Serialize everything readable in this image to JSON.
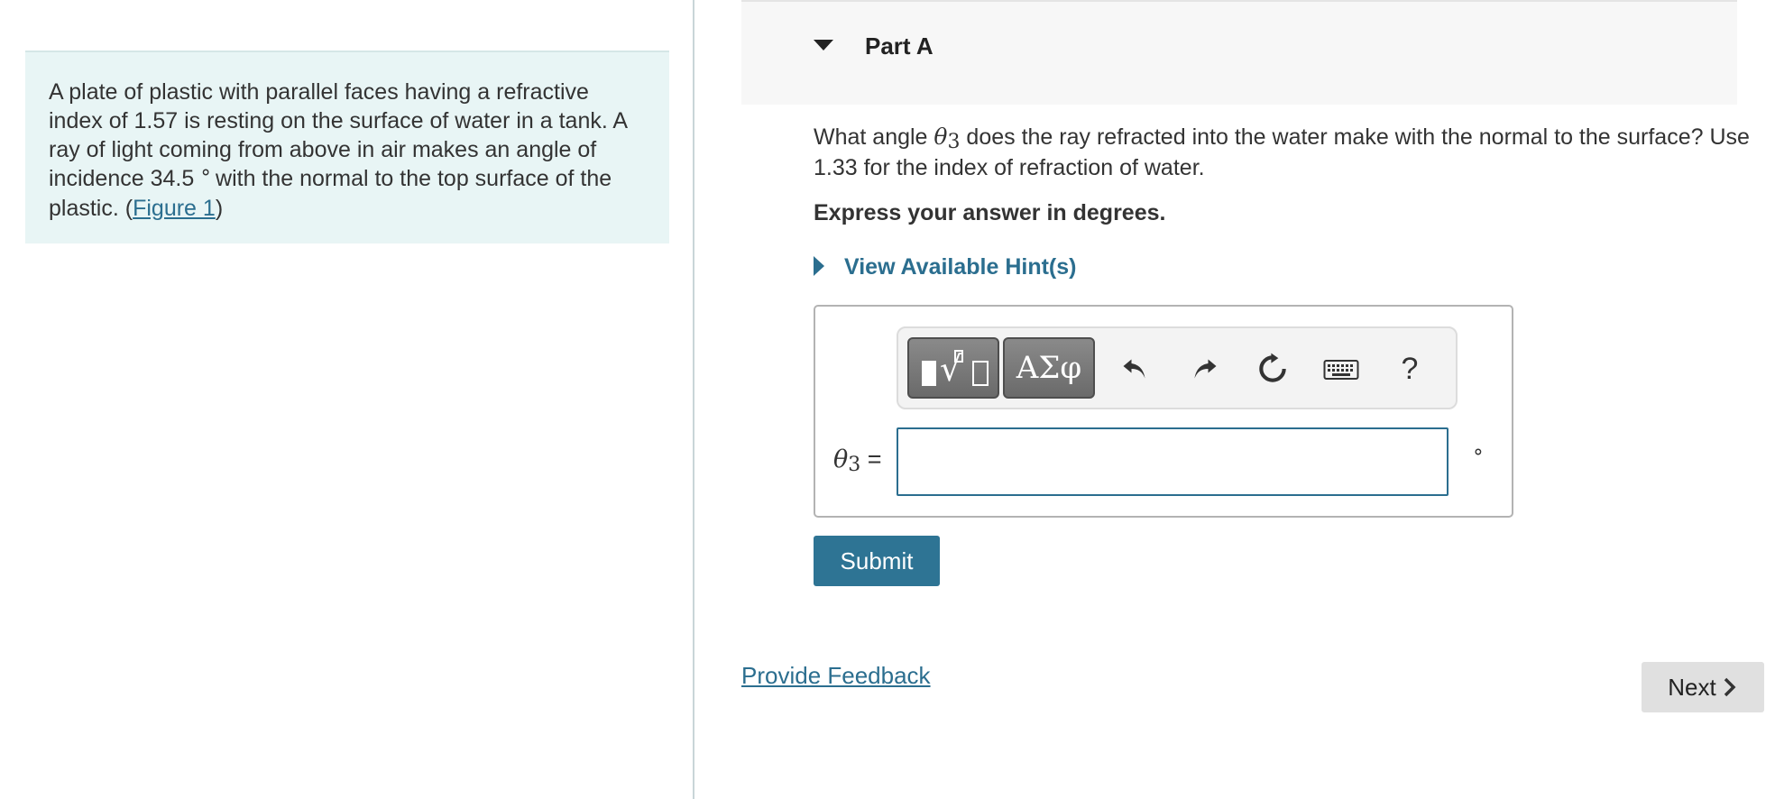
{
  "problem": {
    "text_before": "A plate of plastic with parallel faces having a refractive index of 1.57 is resting on the surface of water in a tank. A ray of light coming from above in air makes an angle of incidence 34.5",
    "degree_symbol": "∘",
    "text_after": "with the normal to the top surface of the plastic. (",
    "figure_link": "Figure 1",
    "text_close": ")"
  },
  "part": {
    "title": "Part A",
    "question_before": "What angle ",
    "theta": "θ",
    "theta_sub": "3",
    "question_after": " does the ray refracted into the water make with the normal to the surface? Use 1.33 for the index of refraction of water.",
    "instruction": "Express your answer in degrees.",
    "hint_link": "View Available Hint(s)"
  },
  "toolbar": {
    "templates_icon": "templates-icon",
    "greek_label": "ΑΣφ",
    "undo_icon": "undo-icon",
    "redo_icon": "redo-icon",
    "reset_icon": "reset-icon",
    "keyboard_icon": "keyboard-icon",
    "help_label": "?"
  },
  "answer": {
    "label_theta": "θ",
    "label_sub": "3",
    "label_eq": " =",
    "value": "",
    "unit": "∘"
  },
  "buttons": {
    "submit": "Submit",
    "feedback": "Provide Feedback",
    "next": "Next"
  },
  "colors": {
    "accent": "#2b6e8f",
    "problem_bg": "#e8f5f5",
    "submit_bg": "#2e7494"
  }
}
